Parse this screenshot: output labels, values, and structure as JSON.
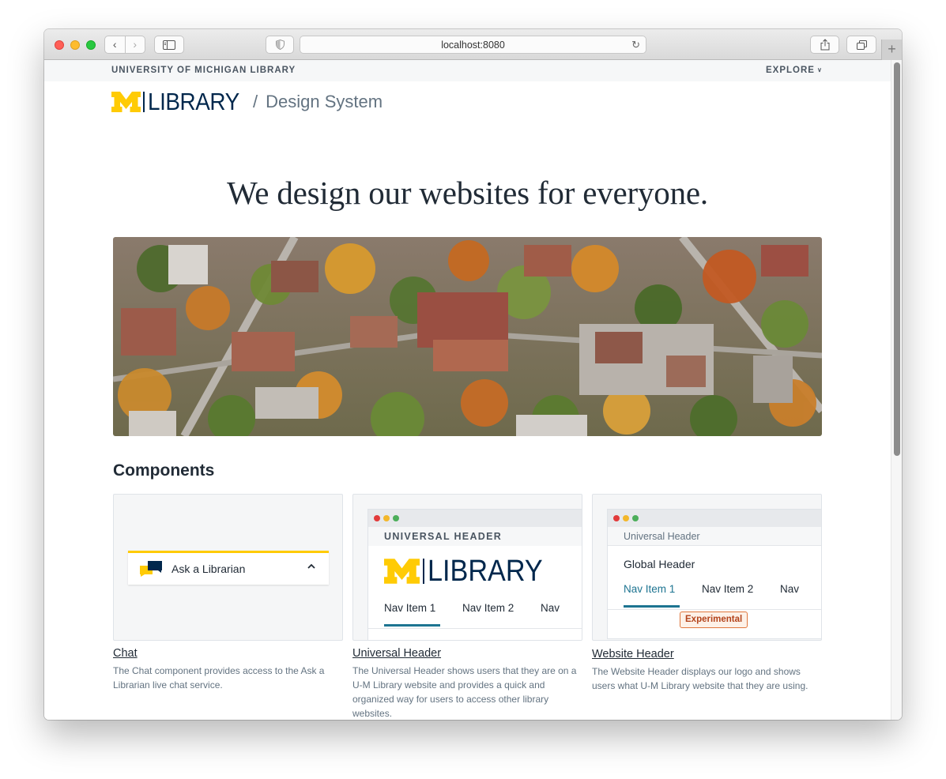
{
  "browser": {
    "address": "localhost:8080",
    "new_tab": "+"
  },
  "header": {
    "university": "UNIVERSITY OF MICHIGAN LIBRARY",
    "explore": "EXPLORE",
    "logo_word": "LIBRARY",
    "slash": "/",
    "site_name": "Design System"
  },
  "hero": {
    "title": "We design our websites for everyone."
  },
  "components": {
    "title": "Components",
    "cards": [
      {
        "name": "Chat",
        "description": "The Chat component provides access to the Ask a Librarian live chat service.",
        "preview": {
          "label": "Ask a Librarian"
        }
      },
      {
        "name": "Universal Header",
        "description": "The Universal Header shows users that they are on a U-M Library website and provides a quick and organized way for users to access other library websites.",
        "preview": {
          "header": "UNIVERSAL HEADER",
          "logo_word": "LIBRARY",
          "nav": [
            "Nav Item 1",
            "Nav Item 2",
            "Nav"
          ]
        }
      },
      {
        "name": "Website Header",
        "badge": "Experimental",
        "description": "The Website Header displays our logo and shows users what U-M Library website that they are using.",
        "preview": {
          "header": "Universal Header",
          "global": "Global Header",
          "nav": [
            "Nav Item 1",
            "Nav Item 2",
            "Nav"
          ]
        }
      }
    ]
  },
  "colors": {
    "maize": "#ffcb05",
    "blue": "#00274c",
    "teal": "#1d7491",
    "badge": "#e0763c"
  }
}
